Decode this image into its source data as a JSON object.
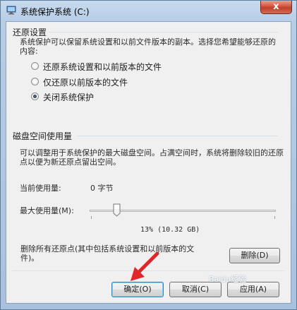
{
  "window": {
    "title": "系统保护系统 (C:)",
    "close_glyph": "x"
  },
  "restore": {
    "section_title": "还原设置",
    "description": "系统保护可以保留系统设置和以前文件版本的副本。选择您希望能够还原的内容:",
    "options": [
      {
        "label": "还原系统设置和以前版本的文件",
        "checked": false
      },
      {
        "label": "仅还原以前版本的文件",
        "checked": false
      },
      {
        "label": "关闭系统保护",
        "checked": true
      }
    ]
  },
  "disk": {
    "section_title": "磁盘空间使用量",
    "description": "可以调整用于系统保护的最大磁盘空间。占满空间时，系统将删除较旧的还原点以便为新还原点留出空间。",
    "current_usage_label": "当前使用量:",
    "current_usage_value": "0 字节",
    "max_usage_label": "最大使用量(M):",
    "max_usage_fraction": 0.13,
    "max_usage_value": "13% (10.32 GB)"
  },
  "delete": {
    "description": "删除所有还原点(其中包括系统设置和以前版本的文件)。",
    "button_label": "删除(D)"
  },
  "buttons": {
    "ok": "确定(O)",
    "cancel": "取消(C)",
    "apply": "应用(A)"
  },
  "watermark": "Baidu经验",
  "colors": {
    "arrow": "#e0262b",
    "close": "#c7462f"
  }
}
